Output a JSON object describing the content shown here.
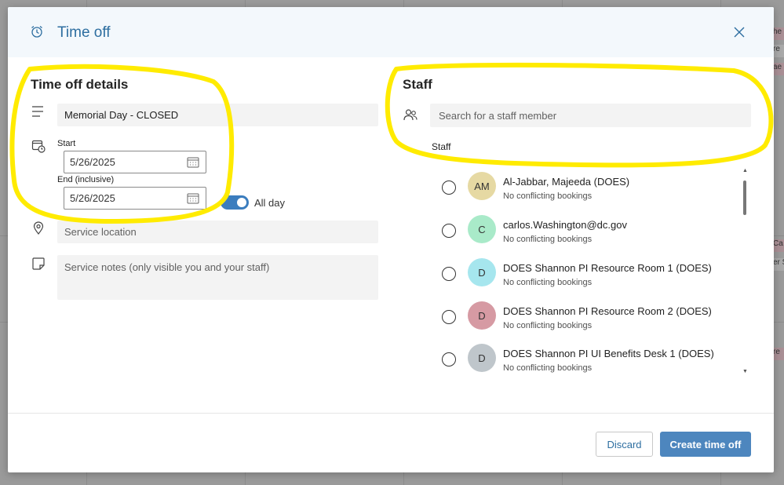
{
  "dialog": {
    "title": "Time off",
    "icons": {
      "title": "alarm-clock-icon",
      "close": "close-icon"
    }
  },
  "details": {
    "heading": "Time off details",
    "title_value": "Memorial Day - CLOSED",
    "start_label": "Start",
    "start_value": "5/26/2025",
    "end_label": "End (inclusive)",
    "end_value": "5/26/2025",
    "all_day_label": "All day",
    "all_day_on": true,
    "location_placeholder": "Service location",
    "notes_placeholder": "Service notes (only visible you and your staff)"
  },
  "staff": {
    "heading": "Staff",
    "search_placeholder": "Search for a staff member",
    "list_label": "Staff",
    "members": [
      {
        "initials": "AM",
        "name": "Al-Jabbar, Majeeda (DOES)",
        "status": "No conflicting bookings",
        "color": "#e6d9a3"
      },
      {
        "initials": "C",
        "name": "carlos.Washington@dc.gov",
        "status": "No conflicting bookings",
        "color": "#a9eac9"
      },
      {
        "initials": "D",
        "name": "DOES Shannon PI Resource Room 1 (DOES)",
        "status": "No conflicting bookings",
        "color": "#a6e6ee"
      },
      {
        "initials": "D",
        "name": "DOES Shannon PI Resource Room 2 (DOES)",
        "status": "No conflicting bookings",
        "color": "#d69aa3"
      },
      {
        "initials": "D",
        "name": "DOES Shannon PI UI Benefits Desk 1 (DOES)",
        "status": "No conflicting bookings",
        "color": "#bfc6cb"
      }
    ]
  },
  "footer": {
    "discard_label": "Discard",
    "create_label": "Create time off"
  },
  "background_chips": [
    "he",
    "re",
    "ae",
    "Ca",
    "er S",
    "re"
  ],
  "colors": {
    "accent": "#4d86be",
    "header_bg": "#f3f8fc",
    "highlight": "#ffeb00"
  }
}
